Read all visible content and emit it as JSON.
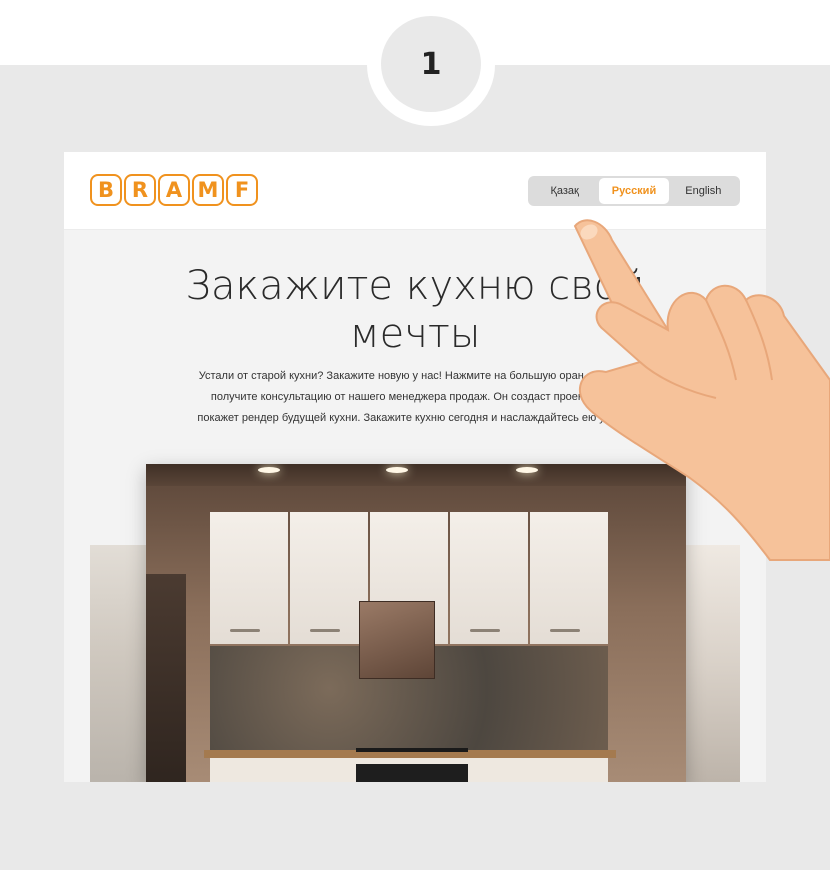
{
  "step": {
    "number": "1"
  },
  "header": {
    "logo_letters": [
      "B",
      "R",
      "A",
      "M",
      "F"
    ],
    "languages": [
      {
        "label": "Қазақ",
        "active": false
      },
      {
        "label": "Русский",
        "active": true
      },
      {
        "label": "English",
        "active": false
      }
    ]
  },
  "hero": {
    "title_line1": "Закажите кухню свой",
    "title_line2": "мечты",
    "description_line1": "Устали от старой кухни? Закажите новую у нас! Нажмите на большую оран… кнопку",
    "description_line2": "получите консультацию от нашего менеджера продаж. Он создаст проект кухни",
    "description_line3": "покажет рендер будущей кухни. Закажите кухню сегодня и наслаждайтесь ею уже за"
  },
  "colors": {
    "accent": "#f0921e",
    "page_bg": "#e9e9e9",
    "hand_skin": "#f6c29a"
  },
  "icons": {
    "pointer": "pointing-hand-icon"
  }
}
